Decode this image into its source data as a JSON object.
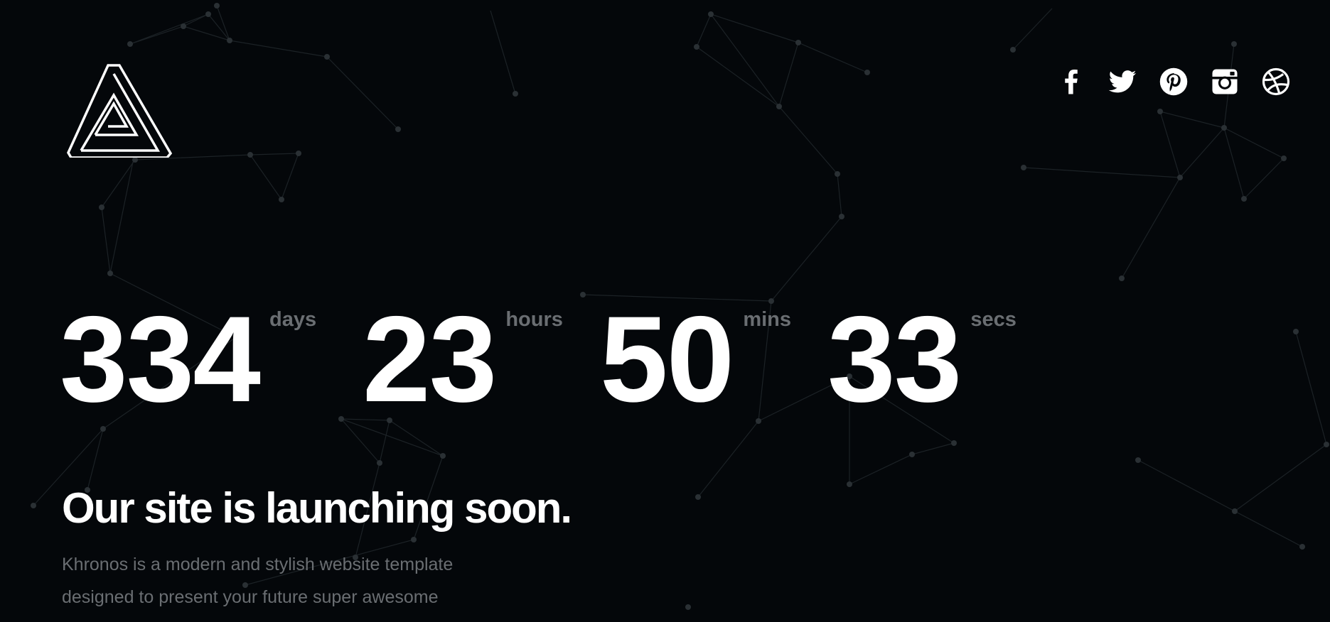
{
  "brand": {
    "logo_icon": "impossible-triangle-logo-icon"
  },
  "social": [
    {
      "name": "facebook",
      "icon": "facebook-icon"
    },
    {
      "name": "twitter",
      "icon": "twitter-icon"
    },
    {
      "name": "pinterest",
      "icon": "pinterest-icon"
    },
    {
      "name": "instagram",
      "icon": "instagram-icon"
    },
    {
      "name": "dribbble",
      "icon": "dribbble-icon"
    }
  ],
  "countdown": {
    "days": {
      "value": "334",
      "label": "days"
    },
    "hours": {
      "value": "23",
      "label": "hours"
    },
    "mins": {
      "value": "50",
      "label": "mins"
    },
    "secs": {
      "value": "33",
      "label": "secs"
    }
  },
  "hero": {
    "headline": "Our site is launching soon.",
    "description": "Khronos is a modern and stylish website template designed to present your future super awesome product or service."
  },
  "colors": {
    "background": "#04070a",
    "text": "#ffffff",
    "muted": "#6a6e72",
    "network_line": "#1c2226"
  }
}
